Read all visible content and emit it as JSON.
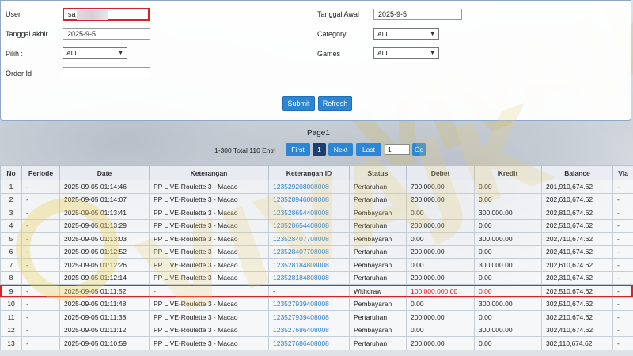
{
  "search": {
    "user_label": "User",
    "user_value": "sa",
    "tanggal_awal_label": "Tanggal Awal",
    "tanggal_awal_value": "2025-9-5",
    "tanggal_akhir_label": "Tanggal akhir",
    "tanggal_akhir_value": "2025-9-5",
    "category_label": "Category",
    "category_value": "ALL",
    "pilih_label": "Pilih :",
    "pilih_value": "ALL",
    "games_label": "Games",
    "games_value": "ALL",
    "order_id_label": "Order Id",
    "order_id_value": "",
    "submit_label": "Submit",
    "refresh_label": "Refresh"
  },
  "pagination": {
    "page_label": "Page1",
    "total_text": "1-300 Total 110 Entri",
    "first_label": "First",
    "current_page": "1",
    "next_label": "Next",
    "last_label": "Last",
    "page_input_value": "1",
    "go_label": "Go"
  },
  "table": {
    "headers": [
      "No",
      "Periode",
      "Date",
      "Keterangan",
      "Keterangan ID",
      "Status",
      "Debet",
      "Kredit",
      "Balance",
      "Via"
    ],
    "rows": [
      [
        "1",
        "-",
        "2025-09-05 01:14:46",
        "PP LIVE-Roulette 3 - Macao",
        "123529208008008",
        "Pertaruhan",
        "700,000.00",
        "0.00",
        "201,910,674.62",
        "-"
      ],
      [
        "2",
        "-",
        "2025-09-05 01:14:07",
        "PP LIVE-Roulette 3 - Macao",
        "123528946008008",
        "Pertaruhan",
        "200,000.00",
        "0.00",
        "202,610,674.62",
        "-"
      ],
      [
        "3",
        "-",
        "2025-09-05 01:13:41",
        "PP LIVE-Roulette 3 - Macao",
        "123528654408008",
        "Pembayaran",
        "0.00",
        "300,000.00",
        "202,810,674.62",
        "-"
      ],
      [
        "4",
        "-",
        "2025-09-05 01:13:29",
        "PP LIVE-Roulette 3 - Macao",
        "123528654408008",
        "Pertaruhan",
        "200,000.00",
        "0.00",
        "202,510,674.62",
        "-"
      ],
      [
        "5",
        "-",
        "2025-09-05 01:13:03",
        "PP LIVE-Roulette 3 - Macao",
        "123528407708008",
        "Pembayaran",
        "0.00",
        "300,000.00",
        "202,710,674.62",
        "-"
      ],
      [
        "6",
        "-",
        "2025-09-05 01:12:52",
        "PP LIVE-Roulette 3 - Macao",
        "123528407708008",
        "Pertaruhan",
        "200,000.00",
        "0.00",
        "202,410,674.62",
        "-"
      ],
      [
        "7",
        "-",
        "2025-09-05 01:12:26",
        "PP LIVE-Roulette 3 - Macao",
        "123528184808008",
        "Pembayaran",
        "0.00",
        "300,000.00",
        "202,610,674.62",
        "-"
      ],
      [
        "8",
        "-",
        "2025-09-05 01:12:14",
        "PP LIVE-Roulette 3 - Macao",
        "123528184808008",
        "Pertaruhan",
        "200,000.00",
        "0.00",
        "202,310,674.62",
        "-"
      ],
      [
        "9",
        "-",
        "2025-09-05 01:11:52",
        "-",
        "-",
        "Withdraw",
        "100,000,000.00",
        "0.00",
        "202,510,674.62",
        "-"
      ],
      [
        "10",
        "-",
        "2025-09-05 01:11:48",
        "PP LIVE-Roulette 3 - Macao",
        "123527939408008",
        "Pembayaran",
        "0.00",
        "300,000.00",
        "302,510,674.62",
        "-"
      ],
      [
        "11",
        "-",
        "2025-09-05 01:11:38",
        "PP LIVE-Roulette 3 - Macao",
        "123527939408008",
        "Pertaruhan",
        "200,000.00",
        "0.00",
        "302,210,674.62",
        "-"
      ],
      [
        "12",
        "-",
        "2025-09-05 01:11:12",
        "PP LIVE-Roulette 3 - Macao",
        "123527686408008",
        "Pembayaran",
        "0.00",
        "300,000.00",
        "302,410,674.62",
        "-"
      ],
      [
        "13",
        "-",
        "2025-09-05 01:10:59",
        "PP LIVE-Roulette 3 - Macao",
        "123527686408008",
        "Pertaruhan",
        "200,000.00",
        "0.00",
        "302,110,674.62",
        "-"
      ]
    ],
    "flagged_row_index": 8
  },
  "colors": {
    "accent": "#2d86d3",
    "highlight_border": "#d0262b",
    "link": "#2f7fcf",
    "alert_text": "#e0161c"
  },
  "watermark_text": "VIVAJK"
}
